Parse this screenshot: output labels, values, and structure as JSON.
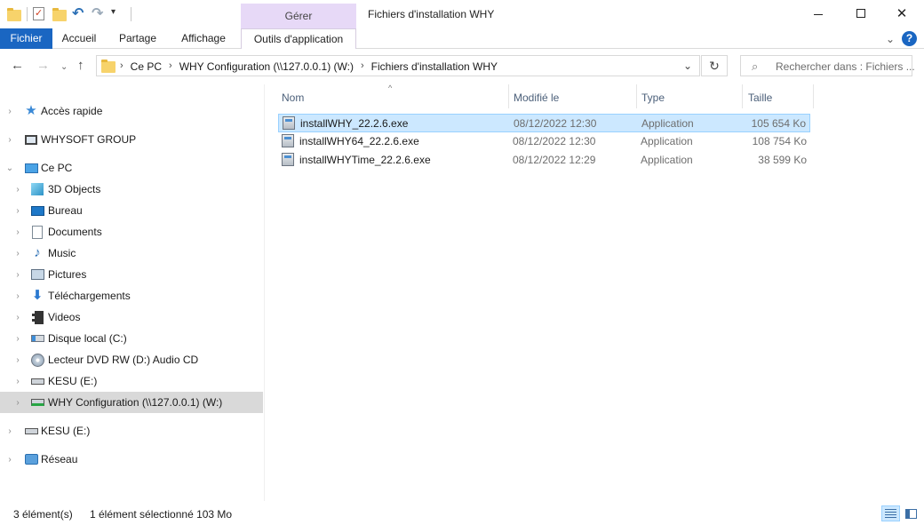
{
  "window": {
    "title": "Fichiers d'installation WHY",
    "contextual_group": "Gérer"
  },
  "quick_access_toolbar": {
    "icons": [
      "folder-icon",
      "properties-icon",
      "new-folder-icon",
      "undo-icon",
      "redo-icon",
      "customize-dropdown-icon"
    ]
  },
  "ribbon": {
    "tabs": [
      {
        "label": "Fichier",
        "active": true
      },
      {
        "label": "Accueil"
      },
      {
        "label": "Partage"
      },
      {
        "label": "Affichage"
      },
      {
        "label": "Outils d'application"
      }
    ]
  },
  "address": {
    "crumbs": [
      "Ce PC",
      "WHY Configuration (\\\\127.0.0.1) (W:)",
      "Fichiers d'installation WHY"
    ]
  },
  "search": {
    "placeholder": "Rechercher dans : Fichiers ..."
  },
  "nav_pane": {
    "items": [
      {
        "label": "Accès rapide",
        "icon": "star-icon"
      },
      {
        "label": "WHYSOFT GROUP",
        "icon": "network-folder-icon"
      },
      {
        "label": "Ce PC",
        "icon": "computer-icon",
        "expanded": true
      },
      {
        "label": "3D Objects",
        "icon": "3d-objects-icon"
      },
      {
        "label": "Bureau",
        "icon": "desktop-icon"
      },
      {
        "label": "Documents",
        "icon": "documents-icon"
      },
      {
        "label": "Music",
        "icon": "music-icon"
      },
      {
        "label": "Pictures",
        "icon": "pictures-icon"
      },
      {
        "label": "Téléchargements",
        "icon": "downloads-icon"
      },
      {
        "label": "Videos",
        "icon": "videos-icon"
      },
      {
        "label": "Disque local (C:)",
        "icon": "local-disk-icon"
      },
      {
        "label": "Lecteur DVD RW (D:) Audio CD",
        "icon": "dvd-drive-icon"
      },
      {
        "label": "KESU (E:)",
        "icon": "usb-drive-icon"
      },
      {
        "label": "WHY Configuration (\\\\127.0.0.1) (W:)",
        "icon": "network-drive-icon",
        "selected": true
      },
      {
        "label": "KESU (E:)",
        "icon": "usb-drive-icon"
      },
      {
        "label": "Réseau",
        "icon": "network-icon"
      }
    ]
  },
  "file_list": {
    "columns": [
      "Nom",
      "Modifié le",
      "Type",
      "Taille"
    ],
    "rows": [
      {
        "name": "installWHY_22.2.6.exe",
        "modified": "08/12/2022 12:30",
        "type": "Application",
        "size": "105 654 Ko",
        "selected": true
      },
      {
        "name": "installWHY64_22.2.6.exe",
        "modified": "08/12/2022 12:30",
        "type": "Application",
        "size": "108 754 Ko"
      },
      {
        "name": "installWHYTime_22.2.6.exe",
        "modified": "08/12/2022 12:29",
        "type": "Application",
        "size": "38 599 Ko"
      }
    ]
  },
  "status": {
    "item_count": "3 élément(s)",
    "selection": "1 élément sélectionné  103 Mo"
  },
  "colors": {
    "accent": "#1a66c2",
    "contextual_tab": "#e7d9f7",
    "selection": "#cce8ff",
    "selection_border": "#99d1ff",
    "nav_selected": "#d9d9d9"
  }
}
